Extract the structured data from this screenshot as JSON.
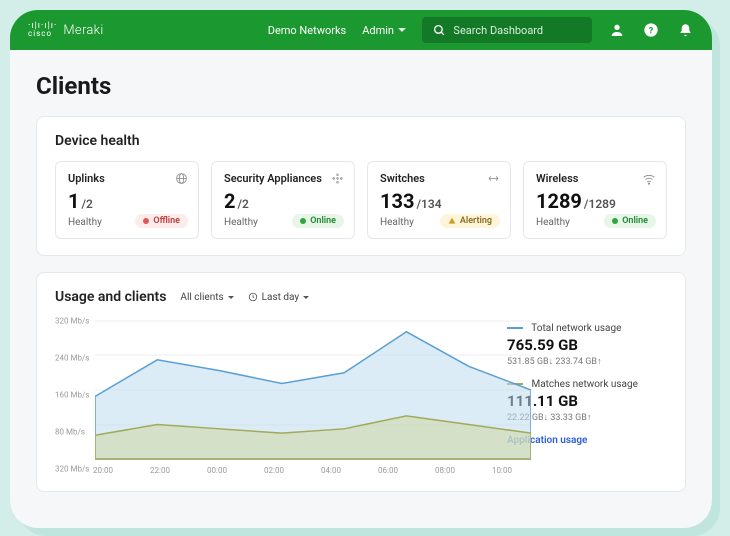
{
  "header": {
    "brand_cisco": "cisco",
    "brand_meraki": "Meraki",
    "demo_networks": "Demo Networks",
    "admin": "Admin",
    "search_placeholder": "Search Dashboard"
  },
  "page_title": "Clients",
  "device_health": {
    "title": "Device health",
    "cards": [
      {
        "title": "Uplinks",
        "value": "1",
        "denom": "/2",
        "sub": "Healthy",
        "pill": {
          "type": "offline",
          "label": "Offline"
        }
      },
      {
        "title": "Security Appliances",
        "value": "2",
        "denom": "/2",
        "sub": "Healthy",
        "pill": {
          "type": "online",
          "label": "Online"
        }
      },
      {
        "title": "Switches",
        "value": "133",
        "denom": "/134",
        "sub": "Healthy",
        "pill": {
          "type": "alerting",
          "label": "Alerting"
        }
      },
      {
        "title": "Wireless",
        "value": "1289",
        "denom": "/1289",
        "sub": "Healthy",
        "pill": {
          "type": "online",
          "label": "Online"
        }
      }
    ]
  },
  "usage": {
    "title": "Usage and clients",
    "filter_clients": "All clients",
    "filter_time": "Last day",
    "ylabels": [
      "320 Mb/s",
      "240 Mb/s",
      "160 Mb/s",
      "80 Mb/s",
      "320 Mb/s"
    ],
    "xlabels": [
      "20:00",
      "22:00",
      "00:00",
      "02:00",
      "04:00",
      "06:00",
      "08:00",
      "10:00"
    ],
    "legend": {
      "total_label": "Total network usage",
      "total_value": "765.59 GB",
      "total_breakdown": "531.85 GB↓  233.74 GB↑",
      "matches_label": "Matches network usage",
      "matches_value": "111.11 GB",
      "matches_breakdown": "22.22 GB↓  33.33 GB↑",
      "app_link": "Application usage"
    },
    "colors": {
      "total": "#5a9fd4",
      "matches": "#a0aa5a"
    }
  },
  "chart_data": {
    "type": "area",
    "x": [
      "20:00",
      "22:00",
      "00:00",
      "02:00",
      "04:00",
      "06:00",
      "08:00",
      "10:00"
    ],
    "series": [
      {
        "name": "Total network usage",
        "values": [
          145,
          230,
          205,
          175,
          200,
          295,
          215,
          160
        ]
      },
      {
        "name": "Matches network usage",
        "values": [
          55,
          80,
          70,
          60,
          70,
          100,
          80,
          60
        ]
      }
    ],
    "ylabel": "Mb/s",
    "ylim": [
      0,
      320
    ],
    "xlabel": "",
    "title": "Usage and clients"
  }
}
